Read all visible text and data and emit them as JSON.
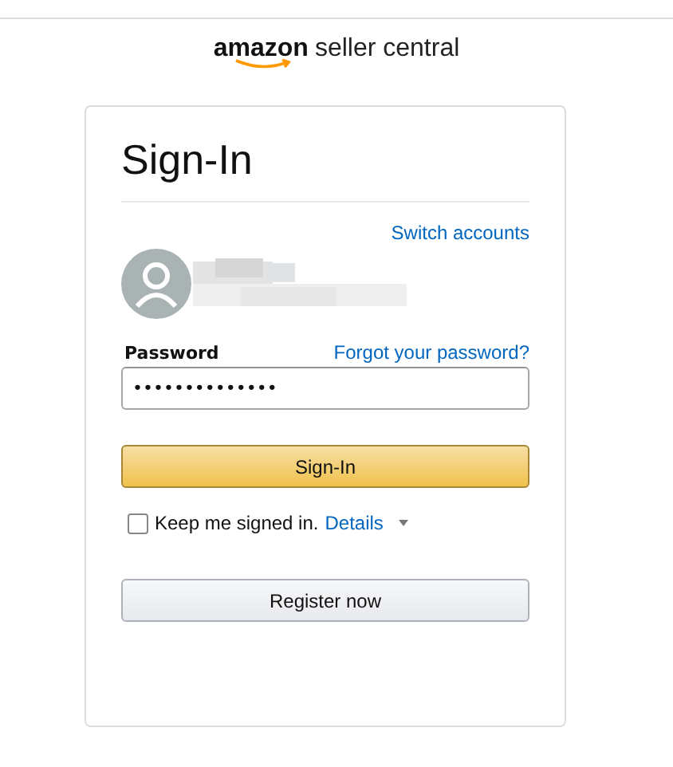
{
  "logo": {
    "brand": "amazon",
    "product": "seller central"
  },
  "card": {
    "title": "Sign-In",
    "switch_link": "Switch accounts",
    "password": {
      "label": "Password",
      "forgot_link": "Forgot your password?",
      "value": "••••••••••••••"
    },
    "sign_in_button": "Sign-In",
    "keep_signed_in": {
      "label": "Keep me signed in.",
      "checked": false,
      "details_link": "Details"
    },
    "register_button": "Register now"
  }
}
